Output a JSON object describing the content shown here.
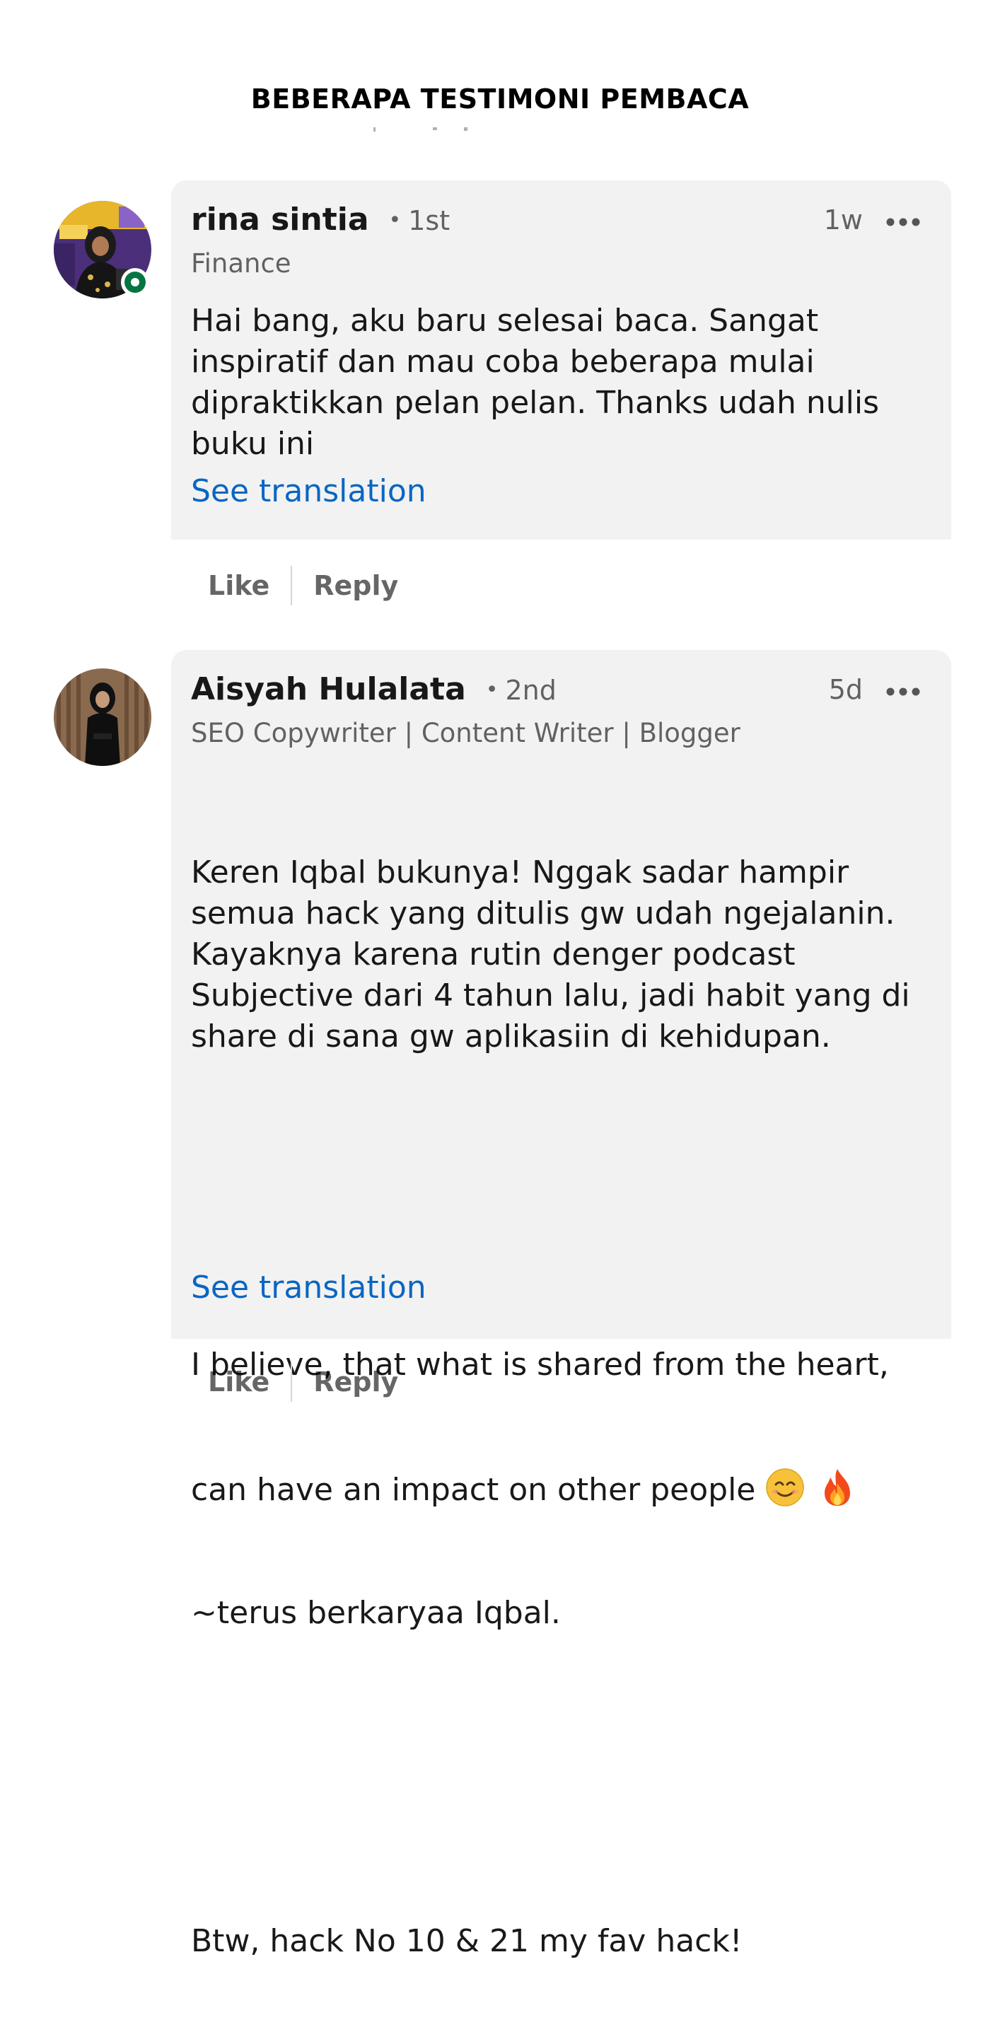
{
  "page": {
    "heading": "BEBERAPA TESTIMONI PEMBACA"
  },
  "comments": [
    {
      "name": "rina sintia",
      "degree": "1st",
      "headline": "Finance",
      "time": "1w",
      "text": "Hai bang, aku baru selesai baca. Sangat\ninspiratif dan mau coba beberapa mulai\ndipraktikkan pelan pelan. Thanks udah nulis\nbuku ini",
      "see_translation": "See translation",
      "like_label": "Like",
      "reply_label": "Reply",
      "online": true
    },
    {
      "name": "Aisyah Hulalata",
      "degree": "2nd",
      "headline": "SEO Copywriter | Content Writer | Blogger",
      "time": "5d",
      "paragraph_1": "Keren Iqbal bukunya! Nggak sadar hampir\nsemua hack yang ditulis gw udah ngejalanin.\nKayaknya karena rutin denger podcast\nSubjective dari 4 tahun lalu, jadi habit yang di\nshare di sana gw aplikasiin di kehidupan.",
      "paragraph_2_line_1": "I believe, that what is shared from the heart,",
      "paragraph_2_line_2": "can have an impact on other people",
      "paragraph_2_line_3": "~terus berkaryaa Iqbal.",
      "emojis": [
        "smiling-face-emoji",
        "fire-emoji"
      ],
      "paragraph_3": "Btw, hack No 10 & 21 my fav hack!",
      "see_translation": "See translation",
      "like_label": "Like",
      "reply_label": "Reply",
      "online": false
    }
  ],
  "colors": {
    "bubble_bg": "#f2f2f2",
    "link_blue": "#0a66c2",
    "online_green": "#057642",
    "muted_text": "#666666"
  }
}
